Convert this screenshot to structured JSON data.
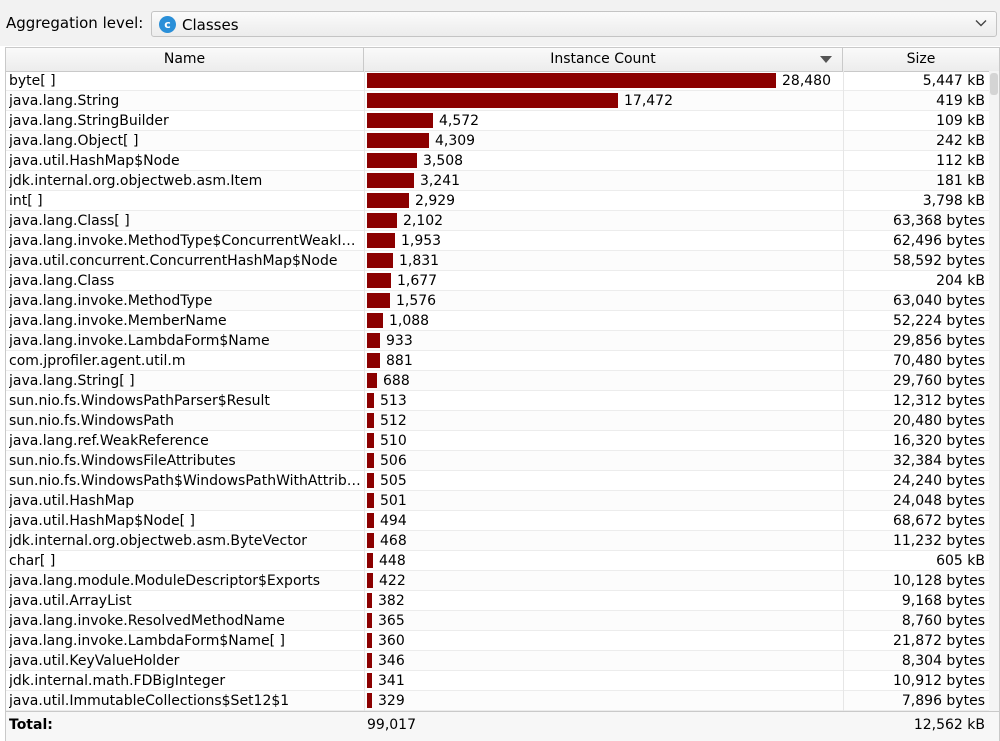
{
  "aggregation": {
    "label": "Aggregation level:",
    "value": "Classes",
    "icon": "class-icon",
    "icon_letter": "c"
  },
  "columns": {
    "name": "Name",
    "count": "Instance Count",
    "size": "Size"
  },
  "bar_color": "#8b0000",
  "max_count": 28480,
  "rows": [
    {
      "name": "byte[ ]",
      "count": 28480,
      "count_label": "28,480",
      "size": "5,447 kB"
    },
    {
      "name": "java.lang.String",
      "count": 17472,
      "count_label": "17,472",
      "size": "419 kB"
    },
    {
      "name": "java.lang.StringBuilder",
      "count": 4572,
      "count_label": "4,572",
      "size": "109 kB"
    },
    {
      "name": "java.lang.Object[ ]",
      "count": 4309,
      "count_label": "4,309",
      "size": "242 kB"
    },
    {
      "name": "java.util.HashMap$Node",
      "count": 3508,
      "count_label": "3,508",
      "size": "112 kB"
    },
    {
      "name": "jdk.internal.org.objectweb.asm.Item",
      "count": 3241,
      "count_label": "3,241",
      "size": "181 kB"
    },
    {
      "name": "int[ ]",
      "count": 2929,
      "count_label": "2,929",
      "size": "3,798 kB"
    },
    {
      "name": "java.lang.Class[ ]",
      "count": 2102,
      "count_label": "2,102",
      "size": "63,368 bytes"
    },
    {
      "name": "java.lang.invoke.MethodType$ConcurrentWeakInternSet$WeakEntry",
      "count": 1953,
      "count_label": "1,953",
      "size": "62,496 bytes"
    },
    {
      "name": "java.util.concurrent.ConcurrentHashMap$Node",
      "count": 1831,
      "count_label": "1,831",
      "size": "58,592 bytes"
    },
    {
      "name": "java.lang.Class",
      "count": 1677,
      "count_label": "1,677",
      "size": "204 kB"
    },
    {
      "name": "java.lang.invoke.MethodType",
      "count": 1576,
      "count_label": "1,576",
      "size": "63,040 bytes"
    },
    {
      "name": "java.lang.invoke.MemberName",
      "count": 1088,
      "count_label": "1,088",
      "size": "52,224 bytes"
    },
    {
      "name": "java.lang.invoke.LambdaForm$Name",
      "count": 933,
      "count_label": "933",
      "size": "29,856 bytes"
    },
    {
      "name": "com.jprofiler.agent.util.m",
      "count": 881,
      "count_label": "881",
      "size": "70,480 bytes"
    },
    {
      "name": "java.lang.String[ ]",
      "count": 688,
      "count_label": "688",
      "size": "29,760 bytes"
    },
    {
      "name": "sun.nio.fs.WindowsPathParser$Result",
      "count": 513,
      "count_label": "513",
      "size": "12,312 bytes"
    },
    {
      "name": "sun.nio.fs.WindowsPath",
      "count": 512,
      "count_label": "512",
      "size": "20,480 bytes"
    },
    {
      "name": "java.lang.ref.WeakReference",
      "count": 510,
      "count_label": "510",
      "size": "16,320 bytes"
    },
    {
      "name": "sun.nio.fs.WindowsFileAttributes",
      "count": 506,
      "count_label": "506",
      "size": "32,384 bytes"
    },
    {
      "name": "sun.nio.fs.WindowsPath$WindowsPathWithAttributes",
      "count": 505,
      "count_label": "505",
      "size": "24,240 bytes"
    },
    {
      "name": "java.util.HashMap",
      "count": 501,
      "count_label": "501",
      "size": "24,048 bytes"
    },
    {
      "name": "java.util.HashMap$Node[ ]",
      "count": 494,
      "count_label": "494",
      "size": "68,672 bytes"
    },
    {
      "name": "jdk.internal.org.objectweb.asm.ByteVector",
      "count": 468,
      "count_label": "468",
      "size": "11,232 bytes"
    },
    {
      "name": "char[ ]",
      "count": 448,
      "count_label": "448",
      "size": "605 kB"
    },
    {
      "name": "java.lang.module.ModuleDescriptor$Exports",
      "count": 422,
      "count_label": "422",
      "size": "10,128 bytes"
    },
    {
      "name": "java.util.ArrayList",
      "count": 382,
      "count_label": "382",
      "size": "9,168 bytes"
    },
    {
      "name": "java.lang.invoke.ResolvedMethodName",
      "count": 365,
      "count_label": "365",
      "size": "8,760 bytes"
    },
    {
      "name": "java.lang.invoke.LambdaForm$Name[ ]",
      "count": 360,
      "count_label": "360",
      "size": "21,872 bytes"
    },
    {
      "name": "java.util.KeyValueHolder",
      "count": 346,
      "count_label": "346",
      "size": "8,304 bytes"
    },
    {
      "name": "jdk.internal.math.FDBigInteger",
      "count": 341,
      "count_label": "341",
      "size": "10,912 bytes"
    },
    {
      "name": "java.util.ImmutableCollections$Set12$1",
      "count": 329,
      "count_label": "329",
      "size": "7,896 bytes"
    }
  ],
  "total": {
    "label": "Total:",
    "count": "99,017",
    "size": "12,562 kB"
  }
}
